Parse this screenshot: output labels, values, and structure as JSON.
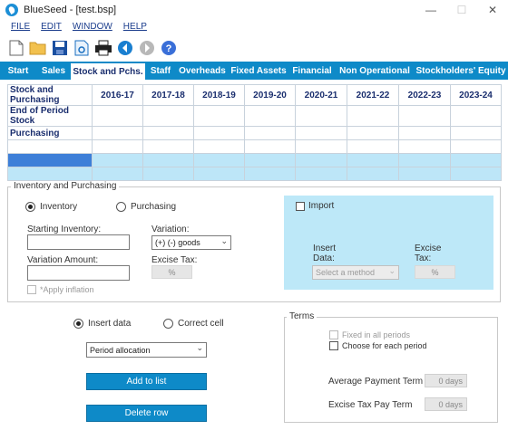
{
  "window": {
    "title": "BlueSeed - [test.bsp]"
  },
  "menu": [
    "FILE",
    "EDIT",
    "WINDOW",
    "HELP"
  ],
  "tabs": [
    {
      "label": "Start",
      "active": false
    },
    {
      "label": "Sales",
      "active": false
    },
    {
      "label": "Stock and Pchs.",
      "active": true
    },
    {
      "label": "Staff",
      "active": false
    },
    {
      "label": "Overheads",
      "active": false
    },
    {
      "label": "Fixed Assets",
      "active": false
    },
    {
      "label": "Financial",
      "active": false
    },
    {
      "label": "Non Operational",
      "active": false
    },
    {
      "label": "Stockholders' Equity",
      "active": false
    }
  ],
  "grid": {
    "header": "Stock and Purchasing",
    "years": [
      "2016-17",
      "2017-18",
      "2018-19",
      "2019-20",
      "2020-21",
      "2021-22",
      "2022-23",
      "2023-24"
    ],
    "rows": [
      "End of Period Stock",
      "Purchasing"
    ]
  },
  "inventory": {
    "group_title": "Inventory and Purchasing",
    "radio_inventory": "Inventory",
    "radio_purchasing": "Purchasing",
    "starting_inventory_label": "Starting Inventory:",
    "variation_label": "Variation:",
    "variation_value": "(+) (-) goods",
    "variation_amount_label": "Variation Amount:",
    "excise_tax_label": "Excise Tax:",
    "excise_tax_value": "%",
    "apply_inflation_label": "*Apply inflation"
  },
  "import": {
    "checkbox_label": "Import",
    "insert_data_label_1": "Insert",
    "insert_data_label_2": "Data:",
    "method_placeholder": "Select a method",
    "excise_label_1": "Excise",
    "excise_label_2": "Tax:",
    "excise_value": "%"
  },
  "actions": {
    "radio_insert": "Insert data",
    "radio_correct": "Correct cell",
    "allocation_value": "Period allocation",
    "add_button": "Add to list",
    "delete_button": "Delete row"
  },
  "terms": {
    "group_title": "Terms",
    "fixed_label": "Fixed in all periods",
    "choose_label": "Choose for each period",
    "avg_payment_label": "Average Payment Term",
    "avg_payment_value": "0  days",
    "excise_pay_label": "Excise Tax Pay Term",
    "excise_pay_value": "0  days"
  },
  "colors": {
    "accent": "#0e8ac8",
    "selection": "#bde6f8",
    "current_cell": "#3d7fd8",
    "import_panel": "#bde8f8"
  }
}
